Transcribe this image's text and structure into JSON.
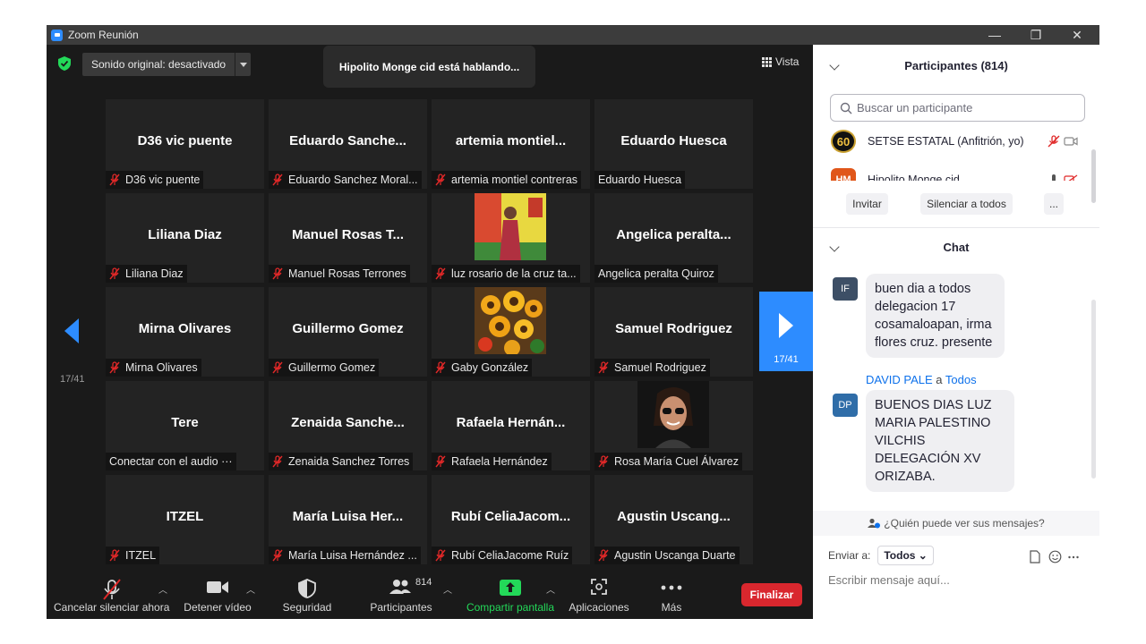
{
  "window": {
    "title": "Zoom Reunión",
    "controls": {
      "minimize": "—",
      "restore": "❐",
      "close": "✕"
    }
  },
  "meeting_top": {
    "audio_dropdown": "Sonido original: desactivado",
    "speaking_banner": "Hipolito Monge  cid está hablando...",
    "view_label": "Vista"
  },
  "pagination": {
    "prev_page": "17/41",
    "next_page": "17/41"
  },
  "tiles": [
    {
      "name": "D36 vic puente",
      "label": "D36 vic puente",
      "muted": true,
      "photo": ""
    },
    {
      "name": "Eduardo  Sanche...",
      "label": "Eduardo Sanchez Moral...",
      "muted": true,
      "photo": ""
    },
    {
      "name": "artemia  montiel...",
      "label": "artemia montiel contreras",
      "muted": true,
      "photo": ""
    },
    {
      "name": "Eduardo Huesca",
      "label": "Eduardo Huesca",
      "muted": false,
      "photo": ""
    },
    {
      "name": "Liliana Diaz",
      "label": "Liliana Diaz",
      "muted": true,
      "photo": ""
    },
    {
      "name": "Manuel Rosas T...",
      "label": "Manuel Rosas Terrones",
      "muted": true,
      "photo": ""
    },
    {
      "name": "",
      "label": "luz rosario de la cruz ta...",
      "muted": true,
      "photo": "woman-yellow-wall"
    },
    {
      "name": "Angelica  peralta...",
      "label": "Angelica peralta Quiroz",
      "muted": false,
      "photo": ""
    },
    {
      "name": "Mirna Olivares",
      "label": "Mirna Olivares",
      "muted": true,
      "photo": ""
    },
    {
      "name": "Guillermo Gomez",
      "label": "Guillermo Gomez",
      "muted": true,
      "photo": ""
    },
    {
      "name": "",
      "label": "Gaby González",
      "muted": true,
      "photo": "sunflowers"
    },
    {
      "name": "Samuel Rodriguez",
      "label": "Samuel Rodriguez",
      "muted": true,
      "photo": ""
    },
    {
      "name": "Tere",
      "label": "Conectar con el audio ···",
      "muted": false,
      "photo": ""
    },
    {
      "name": "Zenaida  Sanche...",
      "label": "Zenaida Sanchez Torres",
      "muted": true,
      "photo": ""
    },
    {
      "name": "Rafaela  Hernán...",
      "label": "Rafaela Hernández",
      "muted": true,
      "photo": ""
    },
    {
      "name": "",
      "label": "Rosa María Cuel Álvarez",
      "muted": true,
      "photo": "woman-sunglasses"
    },
    {
      "name": "ITZEL",
      "label": "ITZEL",
      "muted": true,
      "photo": ""
    },
    {
      "name": "María  Luisa  Her...",
      "label": "María Luisa Hernández ...",
      "muted": true,
      "photo": ""
    },
    {
      "name": "Rubí  CeliaJacom...",
      "label": "Rubí CeliaJacome Ruíz",
      "muted": true,
      "photo": ""
    },
    {
      "name": "Agustin  Uscang...",
      "label": "Agustin Uscanga Duarte",
      "muted": true,
      "photo": ""
    }
  ],
  "toolbar": {
    "unmute": "Cancelar silenciar ahora",
    "stop_video": "Detener vídeo",
    "security": "Seguridad",
    "participants": "Participantes",
    "participants_count": "814",
    "share": "Compartir pantalla",
    "apps": "Aplicaciones",
    "more": "Más",
    "end": "Finalizar",
    "share_color": "#23d959"
  },
  "participants_panel": {
    "title": "Participantes (814)",
    "search_placeholder": "Buscar un participante",
    "rows": [
      {
        "avatar": "60",
        "name": "SETSE ESTATAL (Anfitrión, yo)"
      },
      {
        "avatar": "HM",
        "name": "Hipolito Monge  cid"
      }
    ],
    "invite": "Invitar",
    "mute_all": "Silenciar a todos",
    "more": "..."
  },
  "chat": {
    "title": "Chat",
    "messages": [
      {
        "avatar": "IF",
        "avatar_color": "#3d4f66",
        "sender": "",
        "to_word": "",
        "recipient": "",
        "text": "buen dia a todos delegacion 17 cosamaloapan, irma flores cruz. presente"
      },
      {
        "avatar": "DP",
        "avatar_color": "#2f6da8",
        "sender": "DAVID PALE",
        "to_word": "a",
        "recipient": "Todos",
        "text": "BUENOS DIAS  LUZ MARIA PALESTINO VILCHIS DELEGACIÓN XV ORIZABA."
      }
    ],
    "who_can_see": "¿Quién puede ver sus mensajes?",
    "send_to_label": "Enviar a:",
    "send_to_value": "Todos",
    "input_placeholder": "Escribir mensaje aquí..."
  }
}
